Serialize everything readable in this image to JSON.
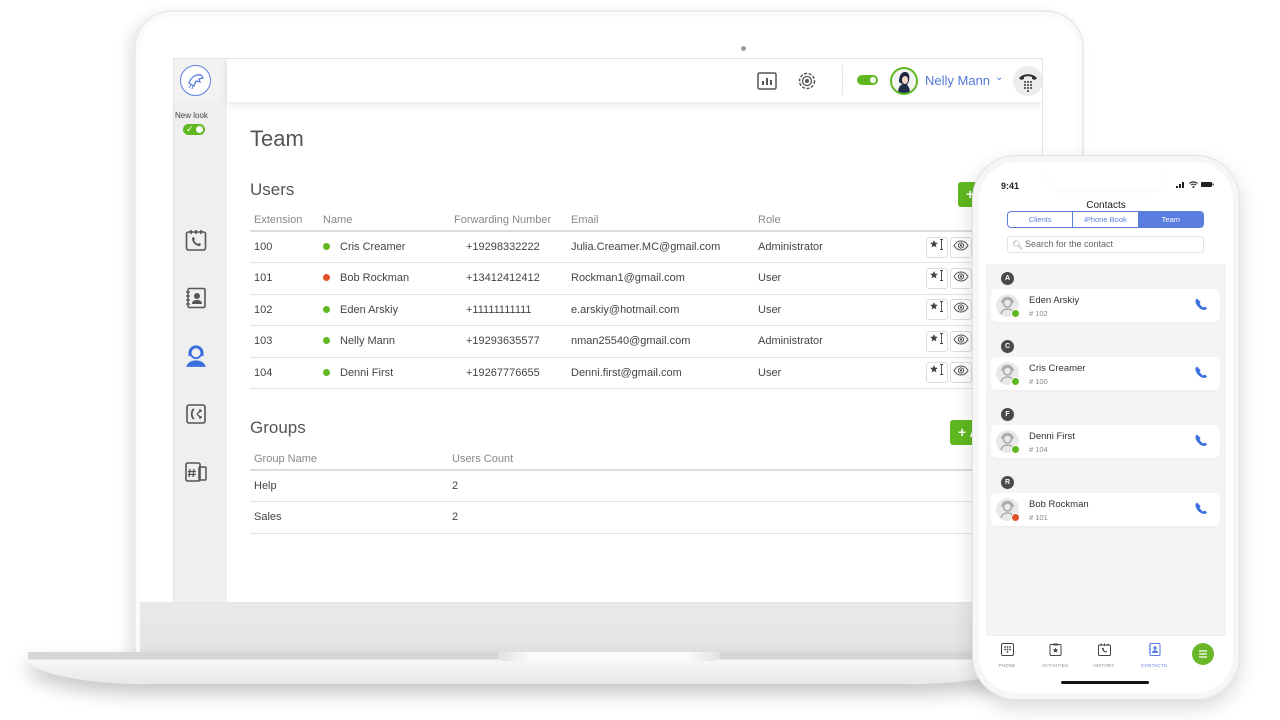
{
  "app": {
    "new_look_label": "New look",
    "new_look_enabled": true,
    "sidebar": {
      "items": [
        {
          "name": "call-history",
          "icon": "calendar-phone-icon",
          "active": false
        },
        {
          "name": "contacts",
          "icon": "address-book-icon",
          "active": false
        },
        {
          "name": "team",
          "icon": "headset-agent-icon",
          "active": true
        },
        {
          "name": "call-routing",
          "icon": "call-split-icon",
          "active": false
        },
        {
          "name": "numbers",
          "icon": "hash-devices-icon",
          "active": false
        }
      ]
    },
    "topbar": {
      "stats_icon": "bar-chart-icon",
      "settings_icon": "gear-icon",
      "status_online": true,
      "user_name": "Nelly Mann",
      "dialpad_icon": "dialpad-phone-icon"
    },
    "page_title": "Team",
    "users": {
      "title": "Users",
      "add_label": "+",
      "columns": [
        "Extension",
        "Name",
        "Forwarding Number",
        "Email",
        "Role"
      ],
      "rows": [
        {
          "extension": "100",
          "name": "Cris Creamer",
          "status": "online",
          "forwarding": "+19298332222",
          "email": "Julia.Creamer.MC@gmail.com",
          "role": "Administrator"
        },
        {
          "extension": "101",
          "name": "Bob Rockman",
          "status": "busy",
          "forwarding": "+13412412412",
          "email": "Rockman1@gmail.com",
          "role": "User"
        },
        {
          "extension": "102",
          "name": "Eden Arskiy",
          "status": "online",
          "forwarding": "+11111111111",
          "email": "e.arskiy@hotmail.com",
          "role": "User"
        },
        {
          "extension": "103",
          "name": "Nelly Mann",
          "status": "online",
          "forwarding": "+19293635577",
          "email": "nman25540@gmail.com",
          "role": "Administrator"
        },
        {
          "extension": "104",
          "name": "Denni First",
          "status": "online",
          "forwarding": "+19267776655",
          "email": "Denni.first@gmail.com",
          "role": "User"
        }
      ],
      "row_actions": [
        "star-cursor-icon",
        "eye-icon"
      ]
    },
    "groups": {
      "title": "Groups",
      "add_label": "+ A",
      "columns": [
        "Group Name",
        "Users Count"
      ],
      "rows": [
        {
          "name": "Help",
          "count": "2"
        },
        {
          "name": "Sales",
          "count": "2"
        }
      ]
    }
  },
  "phone": {
    "time": "9:41",
    "status_icons": "signal wifi battery",
    "title": "Contacts",
    "segments": [
      {
        "label": "Clients",
        "active": false
      },
      {
        "label": "iPhone Book",
        "active": false
      },
      {
        "label": "Team",
        "active": true
      }
    ],
    "search_placeholder": "Search for the contact",
    "contacts": [
      {
        "letter": "A",
        "name": "Eden Arskiy",
        "ext": "# 102",
        "status": "online"
      },
      {
        "letter": "C",
        "name": "Cris Creamer",
        "ext": "# 100",
        "status": "online"
      },
      {
        "letter": "F",
        "name": "Denni First",
        "ext": "# 104",
        "status": "online"
      },
      {
        "letter": "R",
        "name": "Bob Rockman",
        "ext": "# 101",
        "status": "busy"
      }
    ],
    "tabs": [
      {
        "label": "PHONE",
        "icon": "dialpad-icon",
        "active": false
      },
      {
        "label": "ACTIVITIES",
        "icon": "clipboard-star-icon",
        "active": false
      },
      {
        "label": "HISTORY",
        "icon": "calendar-phone-icon",
        "active": false
      },
      {
        "label": "CONTACTS",
        "icon": "address-book-icon",
        "active": true
      }
    ],
    "menu_icon": "hamburger-icon"
  },
  "colors": {
    "accent_blue": "#5478d8",
    "online_green": "#5fb820",
    "busy_red": "#e0522a",
    "segment_blue": "#5a7de0"
  }
}
